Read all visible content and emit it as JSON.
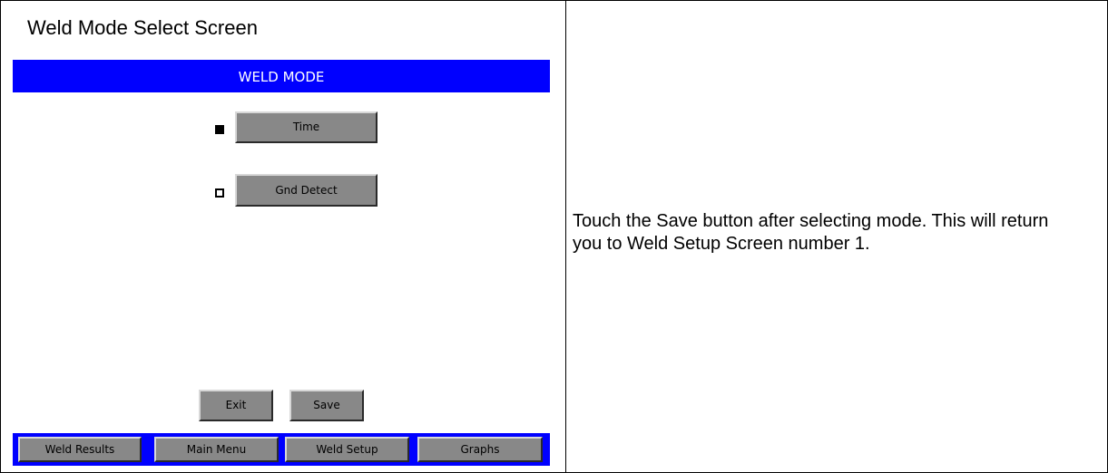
{
  "caption": "Weld Mode Select Screen",
  "screen": {
    "title": "WELD MODE",
    "modes": [
      {
        "label": "Time",
        "selected": true
      },
      {
        "label": "Gnd Detect",
        "selected": false
      }
    ],
    "actions": {
      "exit": "Exit",
      "save": "Save"
    },
    "nav": [
      "Weld Results",
      "Main Menu",
      "Weld Setup",
      "Graphs"
    ]
  },
  "instructions": "Touch the Save button after selecting mode. This will return you to Weld Setup Screen number 1.",
  "colors": {
    "header": "#0000ff",
    "button": "#888888"
  }
}
